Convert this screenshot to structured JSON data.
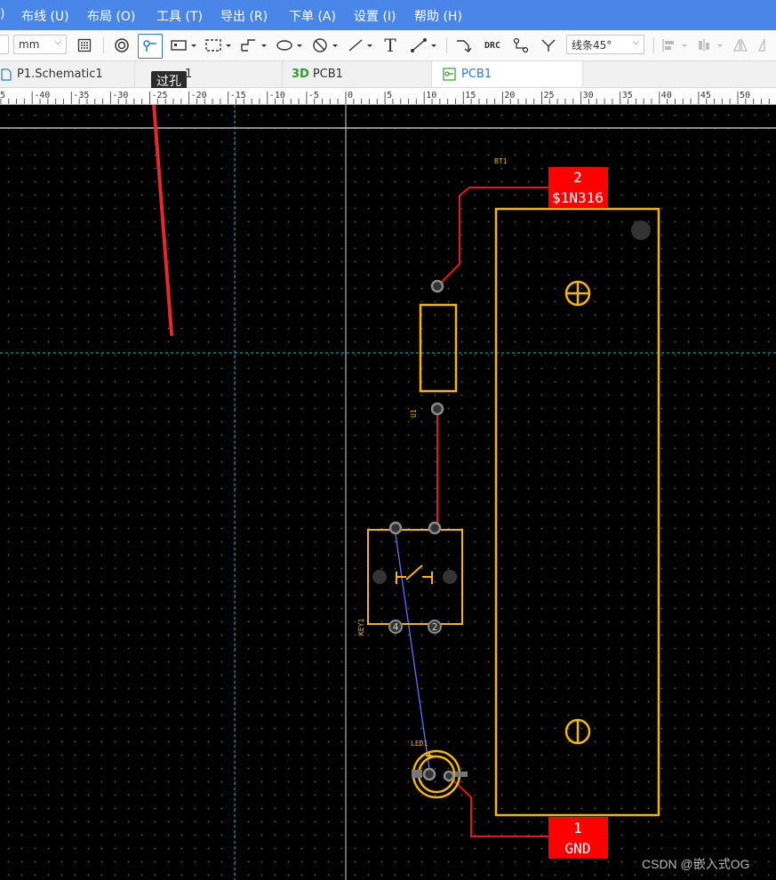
{
  "menu": {
    "partial_left": ")",
    "items": [
      "布线 (U)",
      "布局 (O)",
      "工具 (T)",
      "导出 (R)",
      "下单 (A)",
      "设置 (I)",
      "帮助 (H)"
    ]
  },
  "toolbar": {
    "unit_value": "mm",
    "route_mode_value": "线条45°",
    "drc_label": "DRC",
    "text_tool_glyph": "T"
  },
  "tooltip": {
    "text": "过孔"
  },
  "tabs": [
    {
      "label": "P1.Schematic1"
    },
    {
      "label": "1"
    },
    {
      "label": "PCB1",
      "prefix": "3D"
    },
    {
      "label": "PCB1"
    }
  ],
  "ruler": {
    "labels": [
      "45",
      "-40",
      "-35",
      "-30",
      "-25",
      "-20",
      "-15",
      "-10",
      "-5",
      "0",
      "5",
      "10",
      "15",
      "20",
      "25",
      "30",
      "35",
      "40",
      "45",
      "50"
    ]
  },
  "pcb": {
    "designators": {
      "battery": "BT1",
      "resistor": "U1",
      "switch": "KEY1",
      "led": "LED1"
    },
    "pad_labels": {
      "top_number": "2",
      "top_net": "$1N316",
      "bottom_number": "1",
      "bottom_net": "GND",
      "switch_pad_a": "4",
      "switch_pad_b": "2"
    },
    "colors": {
      "silkscreen": "#f2b705",
      "track": "#e8131f",
      "ratsnest": "#6b6bff",
      "pad": "#7a7a7a",
      "red_pad": "#ff0000"
    }
  },
  "watermark": {
    "text": "CSDN @嵌入式OG"
  }
}
